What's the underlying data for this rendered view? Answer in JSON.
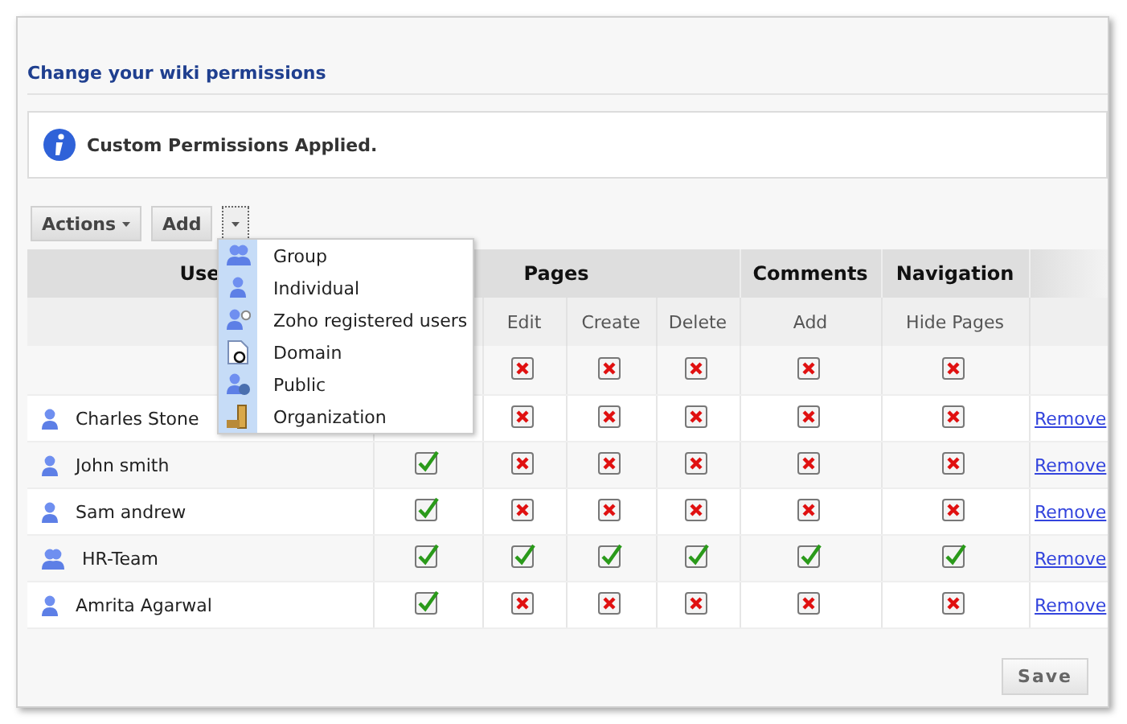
{
  "title": "Change your wiki permissions",
  "message": {
    "text": "Custom Permissions Applied."
  },
  "toolbar": {
    "actions": "Actions",
    "add": "Add"
  },
  "add_menu": {
    "expanded": true,
    "items": [
      {
        "label": "Group",
        "kind": "group"
      },
      {
        "label": "Individual",
        "kind": "individual"
      },
      {
        "label": "Zoho registered users",
        "kind": "registered"
      },
      {
        "label": "Domain",
        "kind": "domain"
      },
      {
        "label": "Public",
        "kind": "public"
      },
      {
        "label": "Organization",
        "kind": "organization"
      }
    ]
  },
  "table": {
    "groups": [
      "Use",
      "Pages",
      "Comments",
      "Navigation"
    ],
    "columns": [
      "Edit",
      "Create",
      "Delete",
      "Add",
      "Hide Pages"
    ],
    "all_row": {
      "permissions": [
        false,
        false,
        false,
        false,
        false
      ]
    },
    "rows": [
      {
        "name": "Charles Stone",
        "kind": "user",
        "permissions": [
          false,
          false,
          false,
          false,
          false
        ],
        "action": "Remove"
      },
      {
        "name": "John smith",
        "kind": "user",
        "view": true,
        "permissions": [
          false,
          false,
          false,
          false,
          false
        ],
        "action": "Remove"
      },
      {
        "name": "Sam andrew",
        "kind": "user",
        "view": true,
        "permissions": [
          false,
          false,
          false,
          false,
          false
        ],
        "action": "Remove"
      },
      {
        "name": "HR-Team",
        "kind": "group",
        "view": true,
        "permissions": [
          true,
          true,
          true,
          true,
          true
        ],
        "action": "Remove"
      },
      {
        "name": "Amrita Agarwal",
        "kind": "user",
        "view": true,
        "permissions": [
          false,
          false,
          false,
          false,
          false
        ],
        "action": "Remove"
      }
    ]
  },
  "save": "Save"
}
